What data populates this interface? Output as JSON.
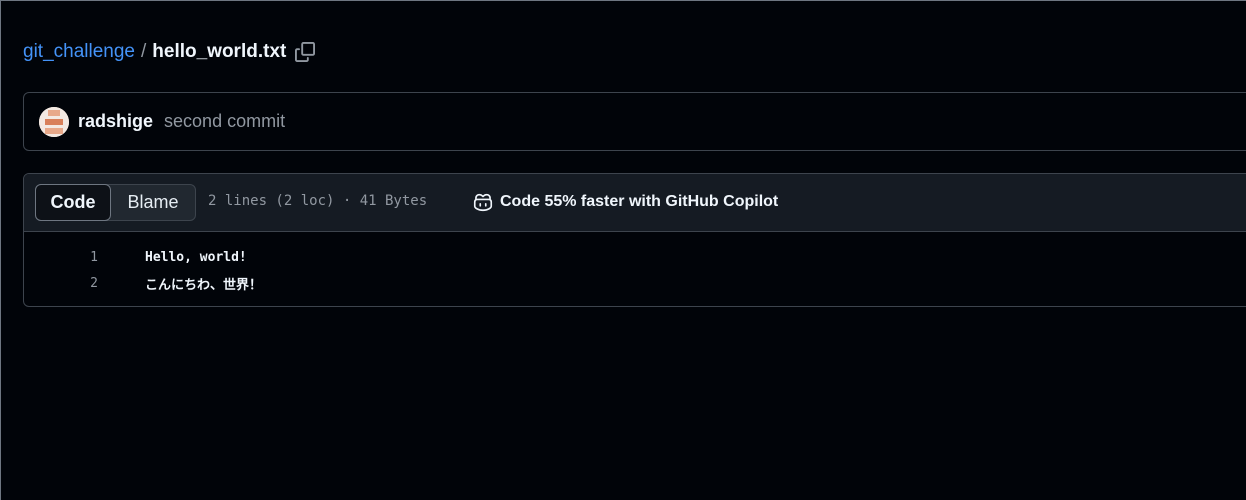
{
  "breadcrumb": {
    "repo": "git_challenge",
    "separator": "/",
    "file": "hello_world.txt",
    "copy_icon": "copy-icon"
  },
  "commit": {
    "author": "radshige",
    "message": "second commit"
  },
  "file_header": {
    "tabs": [
      {
        "label": "Code",
        "selected": true
      },
      {
        "label": "Blame",
        "selected": false
      }
    ],
    "meta": "2 lines (2 loc) · 41 Bytes",
    "copilot_icon": "copilot-icon",
    "copilot_text": "Code 55% faster with GitHub Copilot"
  },
  "code": {
    "lines": [
      {
        "number": "1",
        "text": "Hello, world!"
      },
      {
        "number": "2",
        "text": "こんにちわ、世界！"
      }
    ]
  },
  "colors": {
    "background": "#010409",
    "link": "#4493f8",
    "border": "#3d444d",
    "header_bg": "#151b23",
    "muted": "#9198a1"
  }
}
